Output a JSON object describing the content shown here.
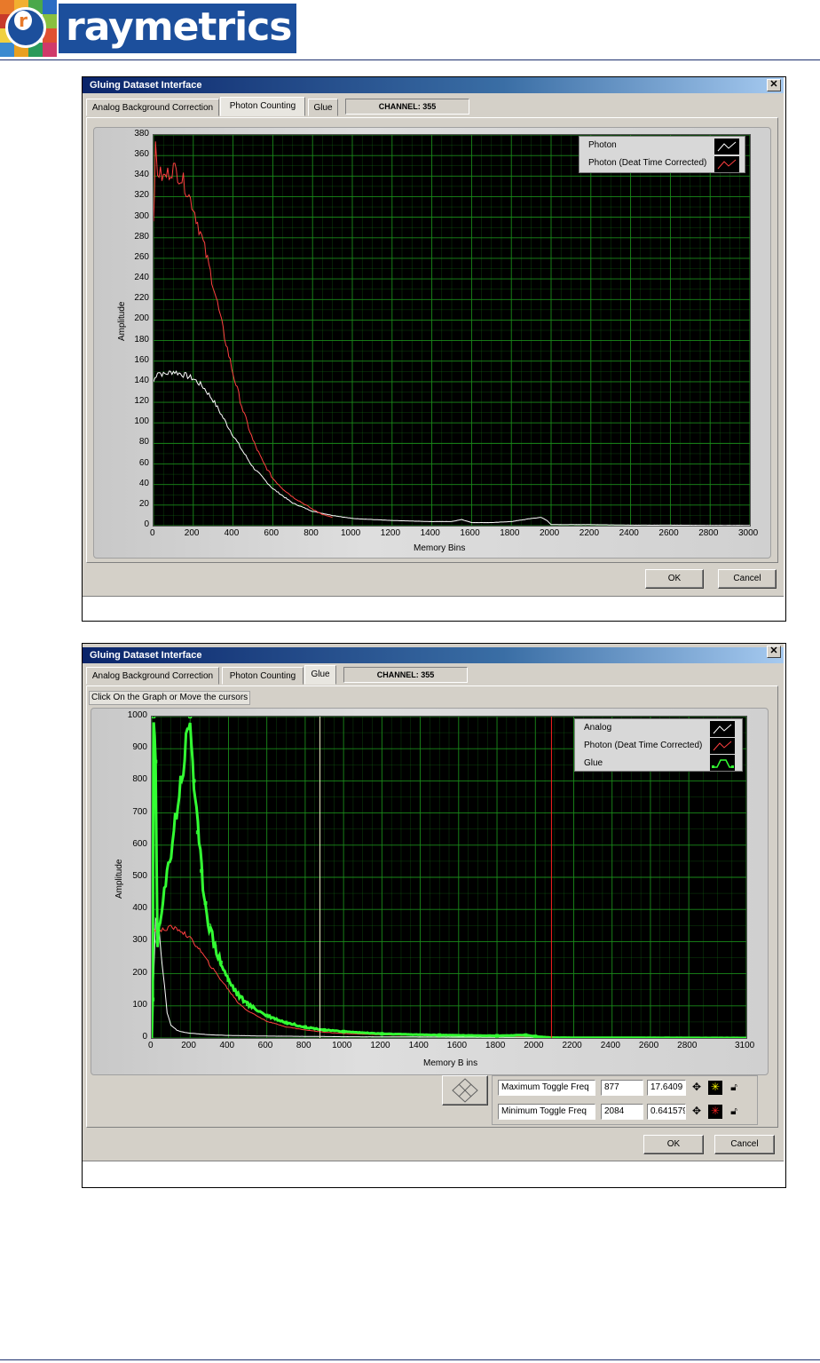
{
  "logo": {
    "text": "raymetrics",
    "letter": "r"
  },
  "window1": {
    "title": "Gluing Dataset Interface",
    "tabs": [
      "Analog Background Correction",
      "Photon Counting",
      "Glue"
    ],
    "active_tab": 1,
    "channel_label": "CHANNEL: 355",
    "ok_label": "OK",
    "cancel_label": "Cancel"
  },
  "window2": {
    "title": "Gluing Dataset Interface",
    "tabs": [
      "Analog Background Correction",
      "Photon Counting",
      "Glue"
    ],
    "active_tab": 2,
    "channel_label": "CHANNEL: 355",
    "instruction": "Click On the Graph or Move the cursors",
    "ok_label": "OK",
    "cancel_label": "Cancel",
    "cursors": [
      {
        "name": "Maximum Toggle Freq",
        "x": "877",
        "y": "17.6409",
        "color": "#ffff00"
      },
      {
        "name": "Minimum Toggle Freq",
        "x": "2084",
        "y": "0.641579",
        "color": "#ff0000"
      }
    ]
  },
  "colors": {
    "grid": "#1a8a1a",
    "photon": "#ffffff",
    "corrected": "#ff4040",
    "glue": "#33ff33",
    "cursor_max": "#e8e8c0",
    "cursor_min": "#ff2020"
  },
  "chart_data": [
    {
      "type": "line",
      "xlabel": "Memory Bins",
      "ylabel": "Amplitude",
      "xlim": [
        0,
        3000
      ],
      "ylim": [
        0,
        380
      ],
      "x_ticks": [
        "0",
        "200",
        "400",
        "600",
        "800",
        "1000",
        "1200",
        "1400",
        "1600",
        "1800",
        "2000",
        "2200",
        "2400",
        "2600",
        "2800",
        "3000"
      ],
      "y_ticks": [
        "0",
        "20",
        "40",
        "60",
        "80",
        "100",
        "120",
        "140",
        "160",
        "180",
        "200",
        "220",
        "240",
        "260",
        "280",
        "300",
        "320",
        "340",
        "360",
        "380"
      ],
      "grid": true,
      "legend_position": "top-right",
      "series": [
        {
          "name": "Photon",
          "color": "#ffffff",
          "x": [
            0,
            20,
            50,
            100,
            150,
            200,
            250,
            300,
            350,
            400,
            450,
            500,
            600,
            700,
            800,
            900,
            1000,
            1200,
            1400,
            1500,
            1550,
            1600,
            1700,
            1800,
            1900,
            1950,
            1980,
            2000,
            2200,
            2400,
            2600,
            2800,
            3000
          ],
          "y": [
            140,
            150,
            147,
            150,
            147,
            143,
            135,
            122,
            105,
            88,
            72,
            57,
            36,
            22,
            14,
            10,
            7,
            5,
            4,
            4,
            6,
            3,
            3,
            4,
            7,
            8,
            5,
            1,
            1,
            0.5,
            0.5,
            0.3,
            0.3
          ]
        },
        {
          "name": "Photon (Deat Time Corrected)",
          "color": "#ff4040",
          "x": [
            0,
            10,
            20,
            50,
            100,
            150,
            200,
            250,
            300,
            350,
            400,
            450,
            500,
            550,
            600,
            650,
            700,
            750,
            800,
            850,
            900
          ],
          "y": [
            300,
            365,
            345,
            338,
            348,
            335,
            310,
            275,
            235,
            190,
            148,
            112,
            83,
            62,
            46,
            36,
            28,
            22,
            16,
            11,
            8
          ]
        }
      ]
    },
    {
      "type": "line",
      "xlabel": "Memory B ins",
      "ylabel": "Amplitude",
      "xlim": [
        0,
        3100
      ],
      "ylim": [
        0,
        1000
      ],
      "x_ticks": [
        "0",
        "200",
        "400",
        "600",
        "800",
        "1000",
        "1200",
        "1400",
        "1600",
        "1800",
        "2000",
        "2200",
        "2400",
        "2600",
        "2800",
        "3100"
      ],
      "y_ticks": [
        "0",
        "100",
        "200",
        "300",
        "400",
        "500",
        "600",
        "700",
        "800",
        "900",
        "1000"
      ],
      "grid": true,
      "legend_position": "top-right",
      "series": [
        {
          "name": "Analog",
          "color": "#ffffff",
          "x": [
            0,
            20,
            40,
            60,
            80,
            100,
            130,
            150,
            200,
            300,
            400,
            600,
            1000,
            1500,
            2000,
            3100
          ],
          "y": [
            0,
            380,
            320,
            200,
            80,
            40,
            25,
            20,
            15,
            10,
            8,
            6,
            4,
            3,
            2,
            1
          ]
        },
        {
          "name": "Photon (Deat Time Corrected)",
          "color": "#ff4040",
          "x": [
            0,
            10,
            30,
            50,
            100,
            150,
            200,
            250,
            300,
            350,
            400,
            450,
            500,
            600,
            700,
            800,
            900,
            1000,
            1200,
            1500,
            2000,
            2100
          ],
          "y": [
            300,
            340,
            330,
            335,
            345,
            335,
            310,
            275,
            230,
            190,
            150,
            110,
            85,
            52,
            35,
            25,
            18,
            14,
            10,
            7,
            5,
            4
          ]
        },
        {
          "name": "Glue",
          "color": "#33ff33",
          "x": [
            0,
            5,
            10,
            20,
            30,
            200,
            220,
            240,
            260,
            280,
            300,
            330,
            360,
            400,
            450,
            500,
            600,
            700,
            800,
            900,
            1000,
            1200,
            1500,
            1800,
            1950,
            2000,
            2084,
            3100
          ],
          "y": [
            0,
            120,
            1000,
            860,
            300,
            1000,
            800,
            640,
            520,
            420,
            350,
            285,
            235,
            180,
            135,
            105,
            70,
            48,
            34,
            25,
            20,
            13,
            9,
            7,
            9,
            5,
            1,
            0
          ]
        }
      ],
      "cursors_x": [
        877,
        2084
      ]
    }
  ]
}
